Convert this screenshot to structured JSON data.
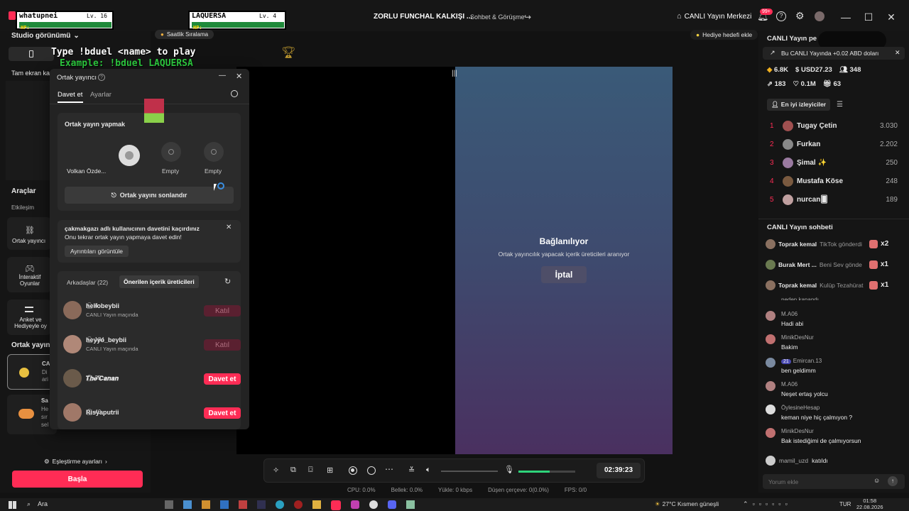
{
  "topbar": {
    "stream_title": "ZORLU FUNCHAL KALKIŞI ...",
    "stream_tag": "Sohbet & Görüşme",
    "live_center": "CANLI Yayın Merkezi",
    "notif_badge": "99+"
  },
  "overlay": {
    "player1_name": "whatupnei",
    "player1_level": "Lv. 16",
    "player2_name": "LAQUERSA",
    "player2_level": "Lv. 4",
    "hp_label": "HP:",
    "line1": "Type !bduel <name> to play",
    "line2": "Example: !bduel LAQUERSA",
    "hourly_rank": "Saatlik Sıralama",
    "gift_goal": "Hediye hedefi ekle"
  },
  "left_panel": {
    "studio_view": "Studio görünümü",
    "fullscreen": "Tam ekran ka",
    "tools_title": "Araçlar",
    "interaction": "Etkileşim",
    "tool_cohost": "Ortak yayıncı",
    "tool_games": "İnteraktif Oyunlar",
    "tool_poll": "Anket ve Hediyeyle oy",
    "cohost_section": "Ortak yayın",
    "card1_title": "CA",
    "card1_line1": "Di",
    "card1_line2": "ari",
    "card2_title": "Sa",
    "card2_line1": "He",
    "card2_line2": "sır",
    "card2_line3": "sel",
    "match_settings": "Eşleştirme ayarları",
    "start_button": "Başla"
  },
  "cohost": {
    "title": "Ortak yayıncı",
    "tab_invite": "Davet et",
    "tab_settings": "Ayarlar",
    "cohosting_label": "Ortak yayın yapmak",
    "host_name": "Volkan Özde...",
    "slot2": "Empty",
    "slot3": "Empty",
    "end_button": "Ortak yayını sonlandır",
    "missed_line1": "çakmakgazı adlı kullanıcının davetini kaçırdınız",
    "missed_line2": "Onu tekrar ortak yayın yapmaya davet edin!",
    "details_button": "Ayrıntıları görüntüle",
    "friends_tab": "Arkadaşlar (22)",
    "suggested_tab": "Önerilen içerik üreticileri",
    "friends": [
      {
        "name": "hellobeybii",
        "count": "4",
        "status": "CANLI Yayın maçında",
        "action": "Katıl",
        "enabled": false,
        "color": "#8a6a5a"
      },
      {
        "name": "heyyo_beybii",
        "count": "184",
        "status": "CANLI Yayın maçında",
        "action": "Katıl",
        "enabled": false,
        "color": "#b08878"
      },
      {
        "name": "𝑻𝒉𝒆'𝑪𝒂𝒏𝒂𝒏",
        "count": "35",
        "status": "",
        "action": "Davet et",
        "enabled": true,
        "color": "#6a5a4a"
      },
      {
        "name": "Risyaputrii",
        "count": "40",
        "status": "",
        "action": "Davet et",
        "enabled": true,
        "color": "#a07868"
      }
    ]
  },
  "stage": {
    "connecting_title": "Bağlanılıyor",
    "connecting_sub": "Ortak yayıncılık yapacak içerik üreticileri aranıyor",
    "cancel_button": "İptal",
    "timer": "02:39:23",
    "mic_level": 0.55
  },
  "stats": {
    "cpu": "CPU: 0.0%",
    "memory": "Bellek: 0.0%",
    "upload": "Yükle: 0 kbps",
    "dropped": "Düşen çerçeve: 0(0.0%)",
    "fps": "FPS: 0/0"
  },
  "right_panel": {
    "header": "CANLI Yayın pe",
    "banner": "Bu CANLI Yayında +0.02 ABD doları",
    "stat_hearts": "6.8K",
    "stat_usd": "USD27.23",
    "stat_viewers": "348",
    "stat_shares": "183",
    "stat_likes": "0.1M",
    "stat_gifts": "63",
    "top_viewers_tab": "En iyi izleyiciler",
    "ranking": [
      {
        "rank": "1",
        "name": "Tugay Çetin",
        "score": "3.030",
        "color": "#a05050"
      },
      {
        "rank": "2",
        "name": "Furkan",
        "score": "2.202",
        "color": "#888"
      },
      {
        "rank": "3",
        "name": "Şimal ✨",
        "score": "250",
        "color": "#9a7aa0"
      },
      {
        "rank": "4",
        "name": "Mustafa Köse",
        "score": "248",
        "color": "#7a5a40"
      },
      {
        "rank": "5",
        "name": "nurcan🂠",
        "score": "189",
        "color": "#c0a0a0"
      }
    ],
    "chat_title": "CANLI Yayın sohbeti",
    "gifts": [
      {
        "name": "Toprak kemal",
        "text": "TikTok gönderdi",
        "mult": "x2",
        "color": "#8a7060"
      },
      {
        "name": "Burak Mert ...",
        "text": "Beni Sev gönde",
        "mult": "x1",
        "color": "#6a7a50"
      },
      {
        "name": "Toprak kemal",
        "text": "Kulüp Tezahürat",
        "mult": "x1",
        "color": "#8a7060"
      }
    ],
    "partial_msg": "neden kapandı",
    "messages": [
      {
        "user": "M.A06",
        "text": "Hadi abi",
        "badge": "",
        "color": "#b08080"
      },
      {
        "user": "MinikDesNur",
        "text": "Bakim",
        "badge": "",
        "color": "#c07070"
      },
      {
        "user": "Emircan.13",
        "text": "ben geldimm",
        "badge": "21",
        "color": "#7a8aa0"
      },
      {
        "user": "M.A06",
        "text": "Neşet ertaş yolcu",
        "badge": "",
        "color": "#b08080"
      },
      {
        "user": "ÖylesineHesap",
        "text": "keman niye hiç çalmıyon ?",
        "badge": "",
        "color": "#ddd"
      },
      {
        "user": "MinikDesNur",
        "text": "Bak istediğimi de çalmıyorsun",
        "badge": "",
        "color": "#c07070"
      }
    ],
    "joined_user": "mamil_uzd",
    "joined_text": "katıldı",
    "comment_placeholder": "Yorum ekle"
  },
  "taskbar": {
    "search": "Ara",
    "weather": "27°C  Kısmen güneşli",
    "lang": "TUR",
    "time": "01:58",
    "date": "22.08.2026"
  }
}
